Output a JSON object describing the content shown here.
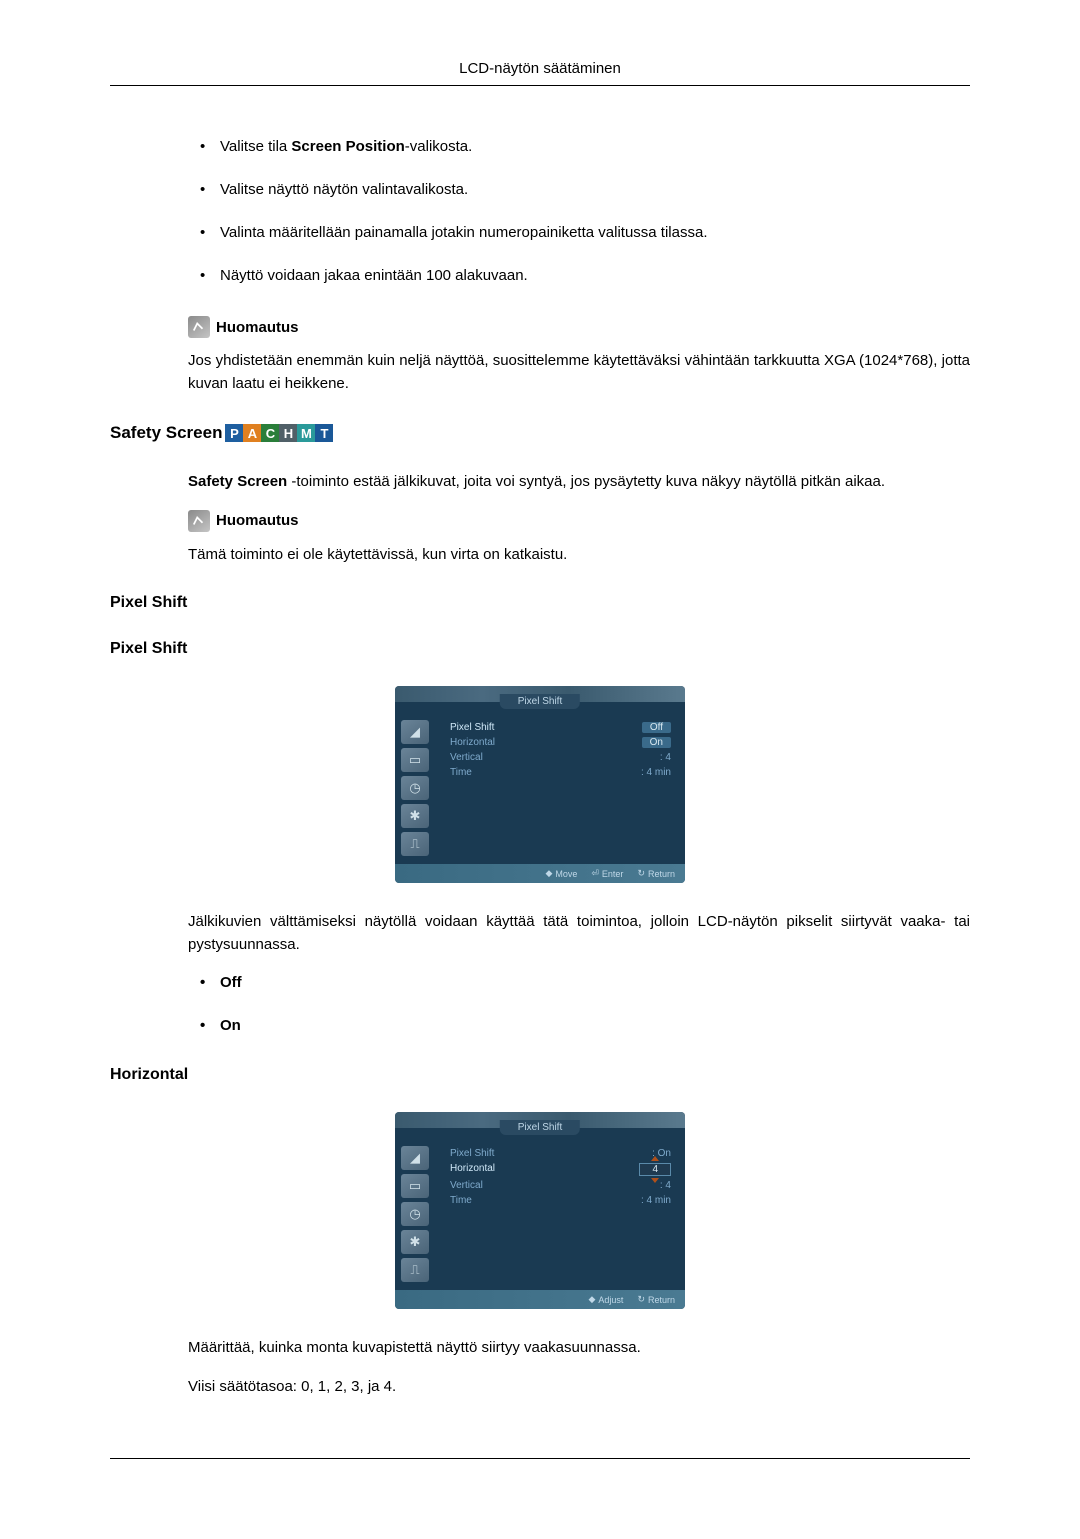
{
  "header": "LCD-näytön säätäminen",
  "intro_bullets": [
    {
      "prefix": "Valitse tila ",
      "bold": "Screen Position",
      "suffix": "-valikosta."
    },
    {
      "prefix": "Valitse näyttö näytön valintavalikosta.",
      "bold": "",
      "suffix": ""
    },
    {
      "prefix": "Valinta määritellään painamalla jotakin numeropainiketta valitussa tilassa.",
      "bold": "",
      "suffix": ""
    },
    {
      "prefix": "Näyttö voidaan jakaa enintään 100 alakuvaan.",
      "bold": "",
      "suffix": ""
    }
  ],
  "note_label": "Huomautus",
  "note1": "Jos yhdistetään enemmän kuin neljä näyttöä, suosittelemme käytettäväksi vähintään tarkkuutta XGA (1024*768), jotta kuvan laatu ei heikkene.",
  "safety_title": "Safety Screen",
  "sources": [
    "P",
    "A",
    "C",
    "H",
    "M",
    "T"
  ],
  "safety_para_bold": "Safety Screen ",
  "safety_para_rest": "-toiminto estää jälkikuvat, joita voi syntyä, jos pysäytetty kuva näkyy näytöllä pitkän aikaa.",
  "note2": "Tämä toiminto ei ole käytettävissä, kun virta on katkaistu.",
  "pixelshift1_title": "Pixel Shift",
  "pixelshift2_title": "Pixel Shift",
  "menu1": {
    "title": "Pixel Shift",
    "rows": [
      {
        "label": "Pixel Shift",
        "value": "Off",
        "highlight": true,
        "selbox": true
      },
      {
        "label": "Horizontal",
        "value": "On",
        "highlight": false,
        "selbox": true
      },
      {
        "label": "Vertical",
        "value": ": 4",
        "highlight": false,
        "selbox": false
      },
      {
        "label": "Time",
        "value": ": 4 min",
        "highlight": false,
        "selbox": false
      }
    ],
    "footer": [
      {
        "icon": "◆",
        "label": "Move"
      },
      {
        "icon": "⏎",
        "label": "Enter"
      },
      {
        "icon": "↻",
        "label": "Return"
      }
    ]
  },
  "pixelshift_desc": "Jälkikuvien välttämiseksi näytöllä voidaan käyttää tätä toimintoa, jolloin LCD-näytön pikselit siirtyvät vaaka- tai pystysuunnassa.",
  "offon": [
    "Off",
    "On"
  ],
  "horizontal_title": "Horizontal",
  "menu2": {
    "title": "Pixel Shift",
    "rows": [
      {
        "label": "Pixel Shift",
        "value": ": On",
        "highlight": false,
        "selbox": false
      },
      {
        "label": "Horizontal",
        "value": "4",
        "highlight": true,
        "inputbox": true
      },
      {
        "label": "Vertical",
        "value": ": 4",
        "highlight": false,
        "selbox": false
      },
      {
        "label": "Time",
        "value": ": 4 min",
        "highlight": false,
        "selbox": false
      }
    ],
    "footer": [
      {
        "icon": "◆",
        "label": "Adjust"
      },
      {
        "icon": "↻",
        "label": "Return"
      }
    ]
  },
  "horizontal_desc": "Määrittää, kuinka monta kuvapistettä näyttö siirtyy vaakasuunnassa.",
  "horizontal_levels": "Viisi säätötasoa: 0, 1, 2, 3, ja 4."
}
